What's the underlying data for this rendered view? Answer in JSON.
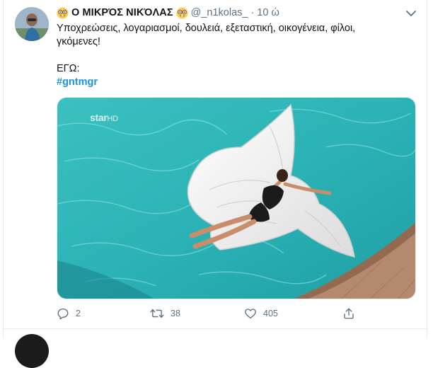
{
  "tweet": {
    "display_name": "Ο ΜΙΚΡΌΣ ΝΙΚΌΛΑΣ",
    "handle": "@_n1kolas_",
    "separator": "·",
    "time": "10 ώ",
    "text_lines": [
      "Υποχρεώσεις, λογαριασμοί, δουλειά, εξεταστική, οικογένεια, φίλοι,",
      "γκόμενες!",
      "ΕΓΩ:"
    ],
    "hashtag": "#gntmgr",
    "media": {
      "watermark": "star",
      "watermark_suffix": "HD"
    },
    "actions": {
      "reply_count": "2",
      "retweet_count": "38",
      "like_count": "405"
    },
    "icons": {
      "name_emoji": "nerd-face-emoji",
      "menu": "chevron-down-icon",
      "reply": "reply-icon",
      "retweet": "retweet-icon",
      "like": "heart-icon",
      "share": "share-icon"
    }
  },
  "colors": {
    "link": "#1b95e0",
    "secondary_text": "#5b7083",
    "pool_water": "#2bb3b5",
    "border": "#e6ecf0"
  }
}
